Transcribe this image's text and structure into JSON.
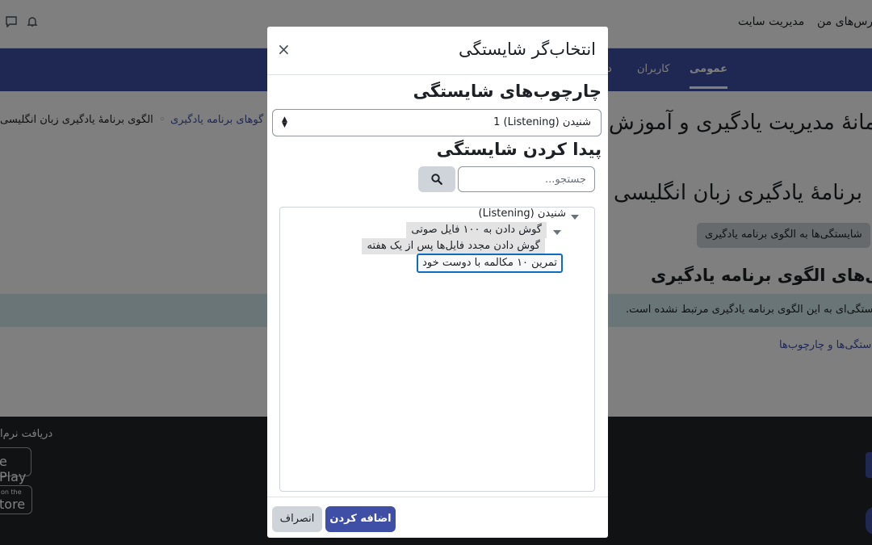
{
  "topbar": {
    "my_courses": "درس‌های من",
    "site_admin": "مدیریت سایت",
    "icons": [
      "chat-icon",
      "bell-icon"
    ]
  },
  "navtabs": {
    "general": "عمومی",
    "users": "کاربران",
    "partial": "د"
  },
  "breadcrumb": {
    "item1": "الگوی برنامهٔ یادگیری زبان انگلیسی",
    "item2": "گوهای برنامه یادگیری",
    "separator": "◦"
  },
  "page": {
    "title": "مانهٔ مدیریت یادگیری و آموزش",
    "plan_heading": "برنامهٔ یادگیری زبان انگلیسی",
    "add_button": "شایستگی‌ها به الگوی برنامه یادگیری",
    "competencies_heading": "گی‌های الگوی برنامه یادگیری",
    "alert_text": "ستگی‌ای به این الگوی برنامه یادگیری مرتبط نشده است.",
    "manage_link": "ستگی‌ها و چارچوب‌ها"
  },
  "footer": {
    "get_app": "دریافت نرم‌ا",
    "google_play": "e Play",
    "app_store_small": "on the",
    "app_store": "tore"
  },
  "modal": {
    "title": "انتخاب‌گر شایستگی",
    "close_glyph": "×",
    "frameworks_heading": "چارچوب‌های شایستگی",
    "framework_selected": "شنیدن (Listening) 1",
    "find_heading": "پیدا کردن شایستگی",
    "search_placeholder": "جستجو...",
    "search_value": "",
    "tree": {
      "root": "شنیدن (Listening)",
      "child": "گوش دادن به ۱۰۰ فایل صوتی",
      "grandchild1": "گوش دادن مجدد فایل‌ها پس از یک هفته",
      "grandchild2": "تمرین ۱۰ مکالمه با دوست خود"
    },
    "add_button": "اضافه کردن",
    "cancel_button": "انصراف"
  },
  "colors": {
    "brand": "#3f4fa6",
    "selected_border": "#0f6cbf",
    "alert_bg": "#d3ebef",
    "footer_bg": "#232529"
  }
}
